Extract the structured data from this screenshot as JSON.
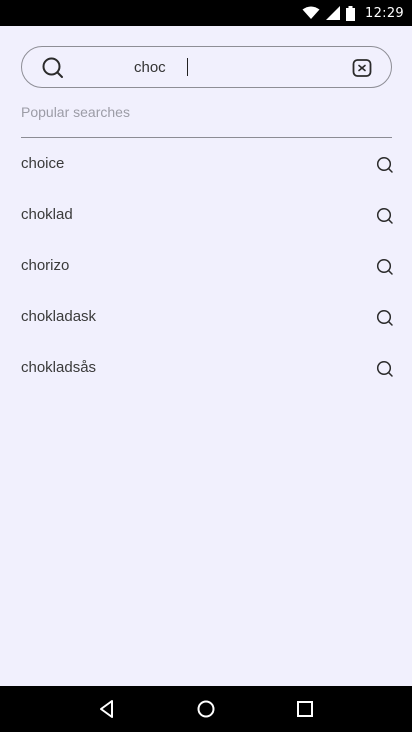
{
  "status_bar": {
    "time": "12:29",
    "icons": [
      "wifi-icon",
      "signal-icon",
      "battery-icon"
    ]
  },
  "search": {
    "value": "choc",
    "lead_icon": "search-icon",
    "clear_icon": "clear-icon"
  },
  "popular": {
    "title": "Popular searches",
    "items": [
      {
        "label": "choice",
        "icon": "search-icon"
      },
      {
        "label": "choklad",
        "icon": "search-icon"
      },
      {
        "label": "chorizo",
        "icon": "search-icon"
      },
      {
        "label": "chokladask",
        "icon": "search-icon"
      },
      {
        "label": "chokladsås",
        "icon": "search-icon"
      }
    ]
  },
  "nav_bar": {
    "buttons": [
      "back-icon",
      "home-icon",
      "recents-icon"
    ]
  },
  "colors": {
    "background": "#f1f0fd",
    "text": "#3a3a3a",
    "muted": "#9c9ca6",
    "border": "#8e8e96"
  }
}
